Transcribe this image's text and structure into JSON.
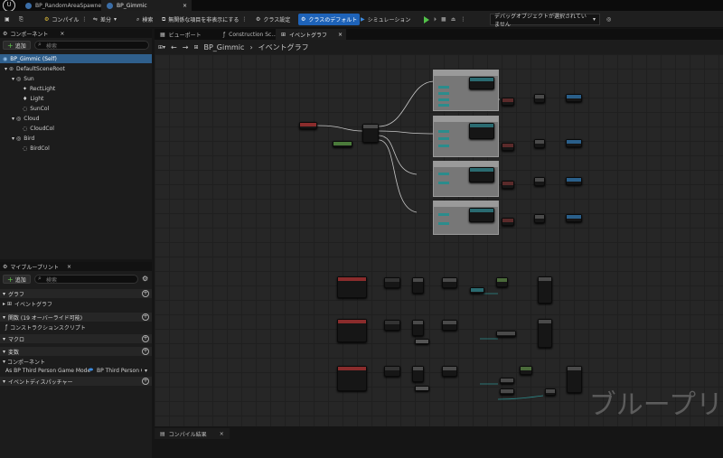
{
  "doc_tabs": [
    {
      "label": "BP_RandomAreaSpawner"
    },
    {
      "label": "BP_Gimmic"
    }
  ],
  "toolbar": {
    "compile": "コンパイル",
    "diff": "差分",
    "find": "検索",
    "hide_unrelated": "無関係な項目を非表示にする",
    "class_settings": "クラス設定",
    "class_defaults": "クラスのデフォルト",
    "simulation": "シミュレーション",
    "debug_object": "デバッグオブジェクトが選択されていません"
  },
  "components": {
    "title": "コンポーネント",
    "add": "追加",
    "search_placeholder": "検索",
    "items": [
      {
        "label": "BP_Gimmic (Self)"
      },
      {
        "label": "DefaultSceneRoot"
      },
      {
        "label": "Sun"
      },
      {
        "label": "RectLight"
      },
      {
        "label": "Light"
      },
      {
        "label": "SunCol"
      },
      {
        "label": "Cloud"
      },
      {
        "label": "CloudCol"
      },
      {
        "label": "Bird"
      },
      {
        "label": "BirdCol"
      }
    ]
  },
  "editor_tabs": [
    {
      "label": "ビューポート"
    },
    {
      "label": "Construction Sc..."
    },
    {
      "label": "イベントグラフ"
    }
  ],
  "breadcrumb": {
    "root": "BP_Gimmic",
    "sep": "›",
    "current": "イベントグラフ"
  },
  "my_blueprint": {
    "title": "マイブループリント",
    "add": "追加",
    "search_placeholder": "検索",
    "graph_section": "グラフ",
    "event_graph": "イベントグラフ",
    "functions_section": "関数 (19 オーバーライド可能)",
    "construction_script": "コンストラクションスクリプト",
    "macros_section": "マクロ",
    "variables_section": "変数",
    "components_section": "コンポーネント",
    "var_name": "As BP Third Person Game Mode",
    "var_type": "BP Third Person Ga",
    "dispatchers_section": "イベントディスパッチャー"
  },
  "compiler": {
    "tab": "コンパイル結果"
  },
  "graph": {
    "watermark": "ブループリ"
  },
  "colors": {
    "accent": "#1e63b9",
    "selection": "#2f5f8c",
    "exec_green": "#52c24a"
  }
}
